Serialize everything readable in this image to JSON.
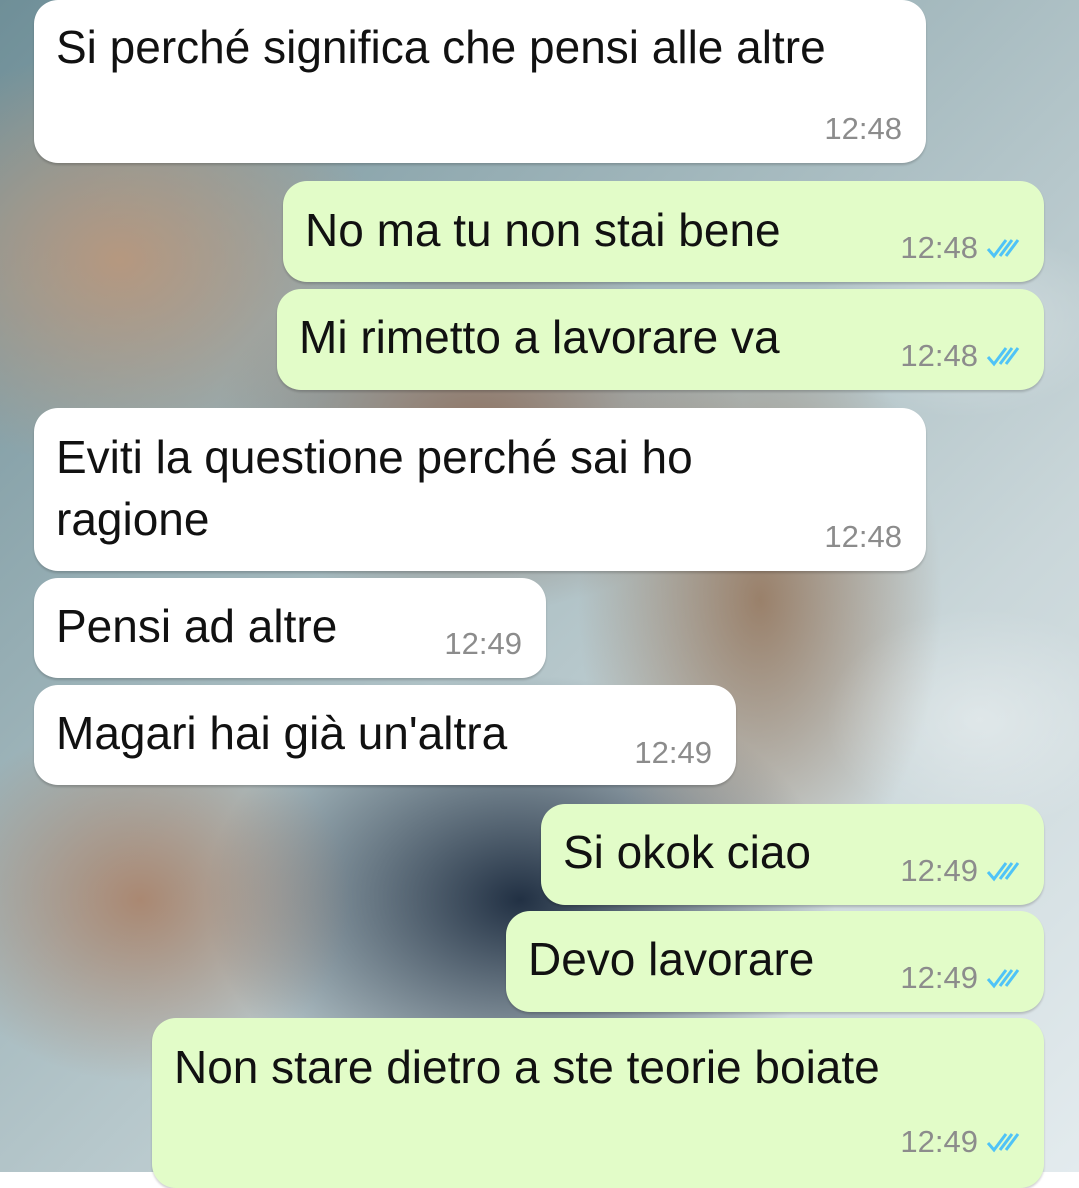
{
  "messages": [
    {
      "dir": "in",
      "text": "Si perché significa che pensi alle altre",
      "time": "12:48"
    },
    {
      "dir": "out",
      "text": "No ma tu non stai bene",
      "time": "12:48",
      "ticks": "read-check-icon"
    },
    {
      "dir": "out",
      "text": "Mi rimetto a lavorare va",
      "time": "12:48",
      "ticks": "read-check-icon"
    },
    {
      "dir": "in",
      "text": "Eviti la questione perché sai ho ragione",
      "time": "12:48"
    },
    {
      "dir": "in",
      "text": "Pensi ad altre",
      "time": "12:49"
    },
    {
      "dir": "in",
      "text": "Magari hai già un'altra",
      "time": "12:49"
    },
    {
      "dir": "out",
      "text": "Si okok ciao",
      "time": "12:49",
      "ticks": "read-check-icon"
    },
    {
      "dir": "out",
      "text": "Devo lavorare",
      "time": "12:49",
      "ticks": "read-check-icon"
    },
    {
      "dir": "out",
      "text": "Non stare dietro a ste teorie boiate",
      "time": "12:49",
      "ticks": "read-check-icon"
    }
  ],
  "colors": {
    "incoming": "#ffffff",
    "outgoing": "#e2fcc8",
    "read_tick": "#4fc3f7"
  }
}
